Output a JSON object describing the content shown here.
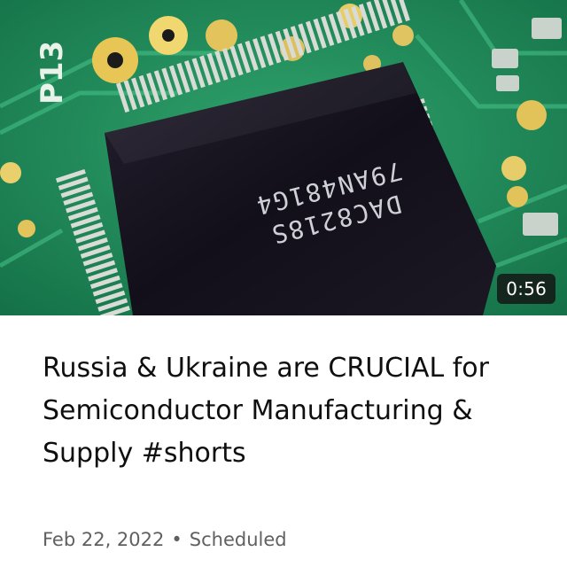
{
  "video": {
    "title": "Russia & Ukraine are CRUCIAL for Semiconductor Manufacturing & Supply #shorts",
    "duration": "0:56",
    "date": "Feb 22, 2022",
    "separator": "•",
    "status": "Scheduled"
  },
  "thumbnail": {
    "board_label": "P13",
    "chip_line_1": "DAC8218S",
    "chip_line_2": "79AN481G4",
    "board_color": "#1f8a5c",
    "chip_color": "#16121f"
  }
}
